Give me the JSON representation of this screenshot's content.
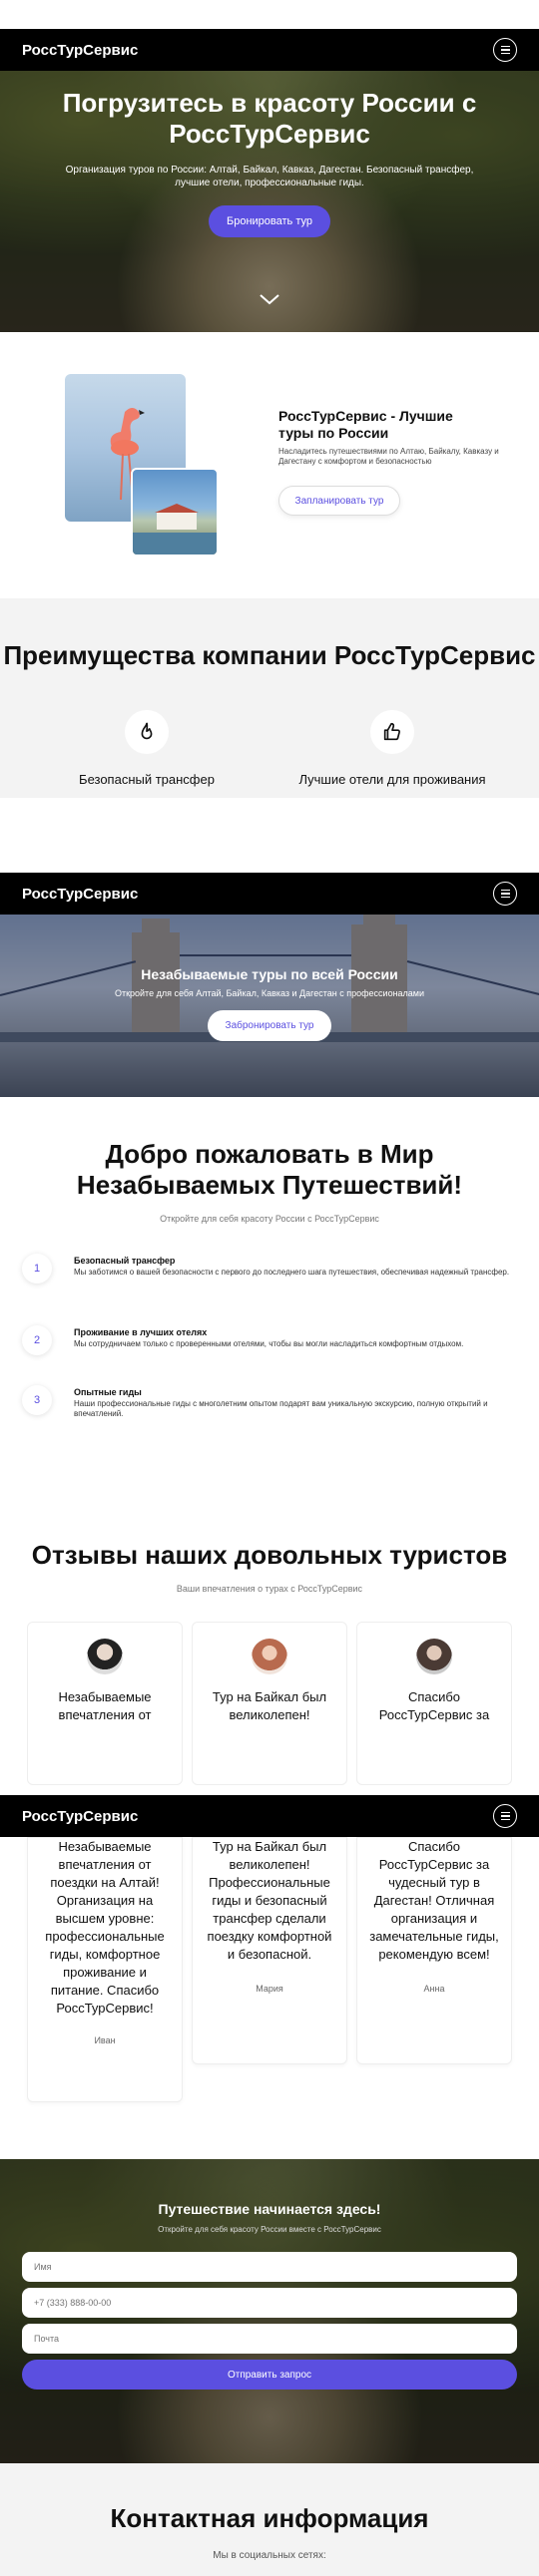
{
  "brand": "РоссТурСервис",
  "hero": {
    "title": "Погрузитесь в красоту России с РоссТурСервис",
    "subtitle": "Организация туров по России: Алтай, Байкал, Кавказ, Дагестан. Безопасный трансфер, лучшие отели, профессиональные гиды.",
    "button": "Бронировать тур"
  },
  "intro": {
    "title": "РоссТурСервис - Лучшие туры по России",
    "description": "Насладитесь путешествиями по Алтаю, Байкалу, Кавказу и Дагестану с комфортом и безопасностью",
    "button": "Запланировать тур"
  },
  "advantages": {
    "title": "Преимущества компании РоссТурСервис",
    "items": [
      {
        "label": "Безопасный трансфер",
        "icon": "flame-icon"
      },
      {
        "label": "Лучшие отели для проживания",
        "icon": "thumbs-up-icon"
      }
    ]
  },
  "banner": {
    "title": "Незабываемые туры по всей России",
    "subtitle": "Откройте для себя Алтай, Байкал, Кавказ и Дагестан с профессионалами",
    "button": "Забронировать тур"
  },
  "welcome": {
    "title": "Добро пожаловать в Мир Незабываемых Путешествий!",
    "subtitle": "Откройте для себя красоту России с РоссТурСервис",
    "steps": [
      {
        "num": "1",
        "title": "Безопасный трансфер",
        "text": "Мы заботимся о вашей безопасности с первого до последнего шага путешествия, обеспечивая надежный трансфер."
      },
      {
        "num": "2",
        "title": "Проживание в лучших отелях",
        "text": "Мы сотрудничаем только с проверенными отелями, чтобы вы могли насладиться комфортным отдыхом."
      },
      {
        "num": "3",
        "title": "Опытные гиды",
        "text": "Наши профессиональные гиды с многолетним опытом подарят вам уникальную экскурсию, полную открытий и впечатлений."
      }
    ]
  },
  "reviews": {
    "title": "Отзывы наших довольных туристов",
    "subtitle": "Ваши впечатления о турах с РоссТурСервис",
    "cards": [
      {
        "head": "Незабываемые впечатления от",
        "text": "Незабываемые впечатления от поездки на Алтай! Организация на высшем уровне: профессиональные гиды, комфортное проживание и питание. Спасибо РоссТурСервис!",
        "name": "Иван"
      },
      {
        "head": "Тур на Байкал был великолепен!",
        "text": "Тур на Байкал был великолепен! Профессиональные гиды и безопасный трансфер сделали поездку комфортной и безопасной.",
        "name": "Мария"
      },
      {
        "head": "Спасибо РоссТурСервис за",
        "text": "Спасибо РоссТурСервис за чудесный тур в Дагестан! Отличная организация и замечательные гиды, рекомендую всем!",
        "name": "Анна"
      }
    ]
  },
  "form": {
    "title": "Путешествие начинается здесь!",
    "subtitle": "Откройте для себя красоту России вместе с РоссТурСервис",
    "name_placeholder": "Имя",
    "phone_placeholder": "+7 (333) 888-00-00",
    "email_placeholder": "Почта",
    "submit": "Отправить запрос"
  },
  "contact": {
    "title": "Контактная информация",
    "subtitle": "Мы в социальных сетях:"
  }
}
